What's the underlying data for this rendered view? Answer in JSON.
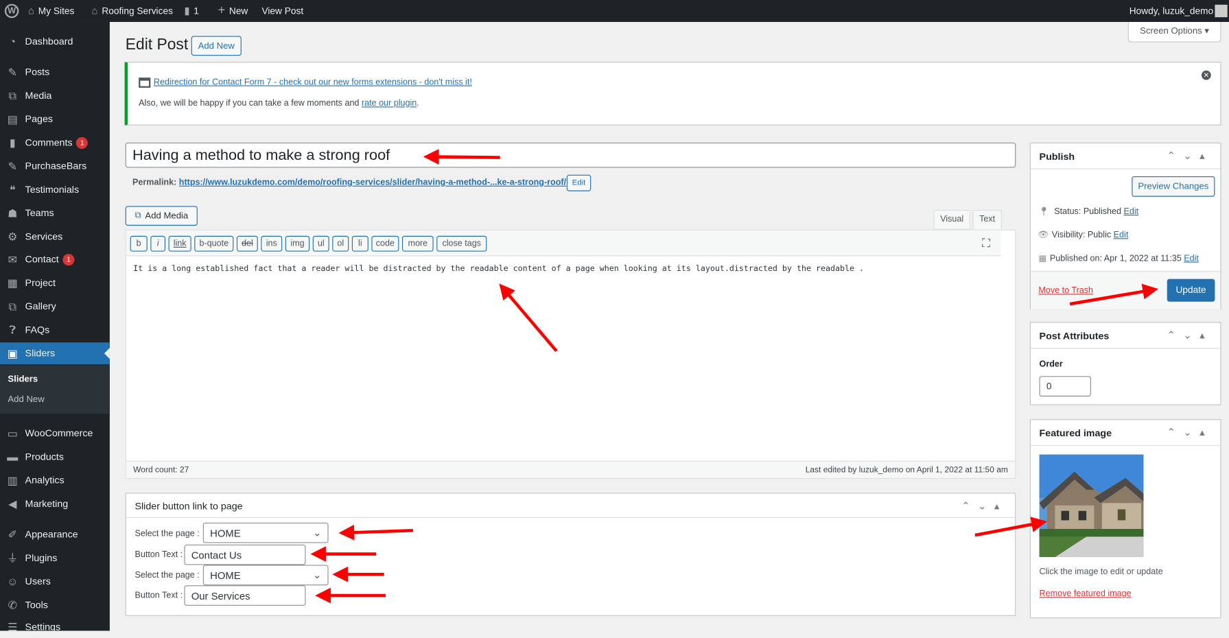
{
  "adminbar": {
    "my_sites": "My Sites",
    "site": "Roofing Services",
    "comments": "1",
    "new": "New",
    "view_post": "View Post",
    "howdy": "Howdy, luzuk_demo"
  },
  "sidebar": {
    "items": [
      {
        "label": "Dashboard",
        "icon": "dashboard-icon"
      },
      {
        "label": "Posts",
        "icon": "pin-icon"
      },
      {
        "label": "Media",
        "icon": "media-icon"
      },
      {
        "label": "Pages",
        "icon": "pages-icon"
      },
      {
        "label": "Comments",
        "icon": "comment-icon",
        "badge": "1"
      },
      {
        "label": "PurchaseBars",
        "icon": "pin-icon"
      },
      {
        "label": "Testimonials",
        "icon": "testimonial-icon"
      },
      {
        "label": "Teams",
        "icon": "groups-icon"
      },
      {
        "label": "Services",
        "icon": "services-icon"
      },
      {
        "label": "Contact",
        "icon": "mail-icon",
        "badge": "1"
      },
      {
        "label": "Project",
        "icon": "grid-icon"
      },
      {
        "label": "Gallery",
        "icon": "media-icon"
      },
      {
        "label": "FAQs",
        "icon": "faq-icon"
      },
      {
        "label": "Sliders",
        "icon": "slides-icon",
        "active": true
      },
      {
        "label": "WooCommerce",
        "icon": "woo-icon"
      },
      {
        "label": "Products",
        "icon": "archive-icon"
      },
      {
        "label": "Analytics",
        "icon": "chart-icon"
      },
      {
        "label": "Marketing",
        "icon": "megaphone-icon"
      },
      {
        "label": "Appearance",
        "icon": "brush-icon"
      },
      {
        "label": "Plugins",
        "icon": "plugin-icon"
      },
      {
        "label": "Users",
        "icon": "users-icon"
      },
      {
        "label": "Tools",
        "icon": "wrench-icon"
      },
      {
        "label": "Settings",
        "icon": "settings-icon"
      }
    ],
    "submenu": [
      "Sliders",
      "Add New"
    ]
  },
  "header": {
    "title": "Edit Post",
    "add_new": "Add New",
    "screen_options": "Screen Options"
  },
  "notice": {
    "link": "Redirection for Contact Form 7 - check out our new forms extensions - don't miss it!",
    "text": "Also, we will be happy if you can take a few moments and",
    "rate_link": "rate our plugin",
    "text_end": "."
  },
  "post": {
    "title": "Having a method to make a strong roof",
    "permalink_label": "Permalink:",
    "permalink": "https://www.luzukdemo.com/demo/roofing-services/slider/having-a-method-...ke-a-strong-roof/",
    "edit": "Edit",
    "add_media": "Add Media",
    "tab_visual": "Visual",
    "tab_text": "Text",
    "quicktags": [
      "b",
      "i",
      "link",
      "b-quote",
      "del",
      "ins",
      "img",
      "ul",
      "ol",
      "li",
      "code",
      "more",
      "close tags"
    ],
    "content": "It is a long established fact that a reader will be distracted by the readable content of a page when looking at its layout.distracted by the readable .",
    "word_count": "Word count: 27",
    "last_edited": "Last edited by luzuk_demo on April 1, 2022 at 11:50 am"
  },
  "slider_box": {
    "title": "Slider button link to page",
    "select_label": "Select the page :",
    "button_label": "Button Text :",
    "select1": "HOME",
    "button1": "Contact Us",
    "select2": "HOME",
    "button2": "Our Services"
  },
  "publish": {
    "title": "Publish",
    "preview": "Preview Changes",
    "status": "Status: Published",
    "visibility": "Visibility: Public",
    "published_on": "Published on: Apr 1, 2022 at 11:35",
    "edit": "Edit",
    "trash": "Move to Trash",
    "update": "Update"
  },
  "attributes": {
    "title": "Post Attributes",
    "order_label": "Order",
    "order": "0"
  },
  "featured": {
    "title": "Featured image",
    "hint": "Click the image to edit or update",
    "remove": "Remove featured image"
  },
  "colors": {
    "accent": "#2271b1",
    "sidebar": "#1d2327",
    "annotation": "#ff0000",
    "notice": "#00a32a"
  }
}
